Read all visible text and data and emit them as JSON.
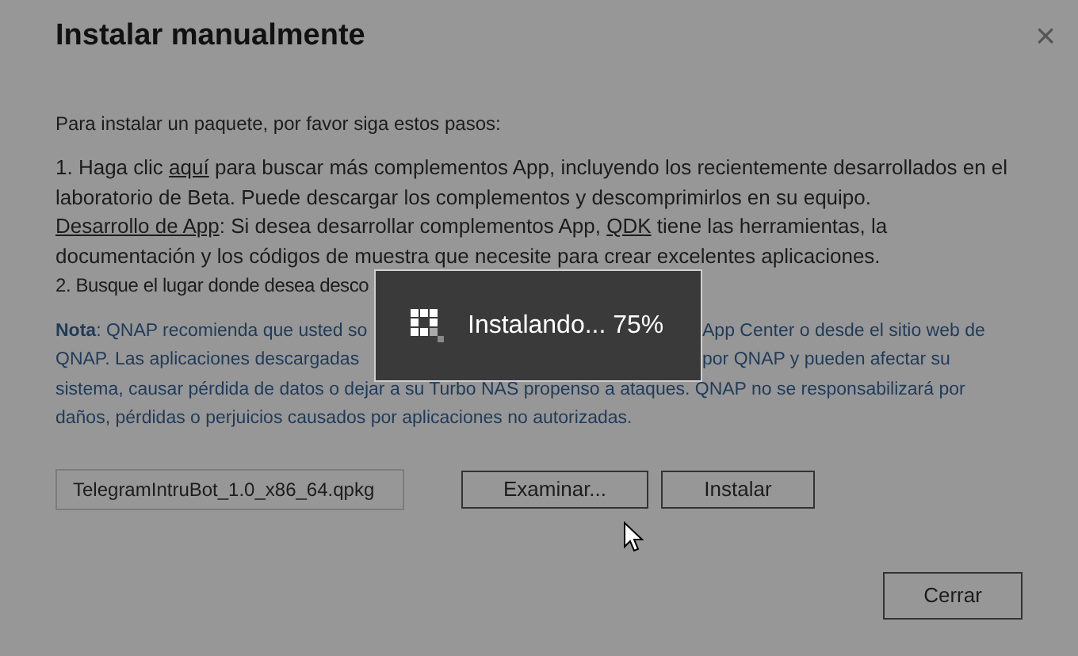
{
  "dialog": {
    "title": "Instalar manualmente",
    "close": "×"
  },
  "intro": "Para instalar un paquete, por favor siga estos pasos:",
  "steps": [
    {
      "parts": [
        {
          "text": "1. Haga clic ",
          "link": false
        },
        {
          "text": "aquí",
          "link": true
        },
        {
          "text": " para buscar más complementos App, incluyendo los recientemente desarrollados en el laboratorio de Beta. Puede descargar los complementos y descomprimirlos en su equipo.",
          "link": false
        }
      ]
    },
    {
      "parts": [
        {
          "text": "Desarrollo de App",
          "link": true
        },
        {
          "text": ": Si desea desarrollar complementos App, ",
          "link": false
        },
        {
          "text": "QDK",
          "link": true
        },
        {
          "text": " tiene las herramientas, la documentación y los códigos de muestra que necesite para crear excelentes aplicaciones.",
          "link": false
        }
      ]
    }
  ],
  "step_2": {
    "left": "2. Busque el lugar donde desea desco"
  },
  "note_lines": [
    {
      "left": "**Nota**: QNAP recomienda que usted so",
      "right": "App Center o desde el sitio web de"
    },
    {
      "left": "QNAP. Las aplicaciones descargadas",
      "right": "por QNAP y pueden afectar su"
    },
    {
      "text": "sistema, causar pérdida de datos o dejar a su Turbo NAS propenso a ataques. QNAP no se responsabilizará por"
    },
    {
      "text": "daños, pérdidas o perjuicios causados por aplicaciones no autorizadas."
    }
  ],
  "file_field": {
    "value": "TelegramIntruBot_1.0_x86_64.qpkg"
  },
  "buttons": [
    {
      "label": "Examinar..."
    },
    {
      "label": "Instalar"
    }
  ],
  "close_button": "Cerrar",
  "toast": {
    "text": "Instalando... 75%"
  }
}
